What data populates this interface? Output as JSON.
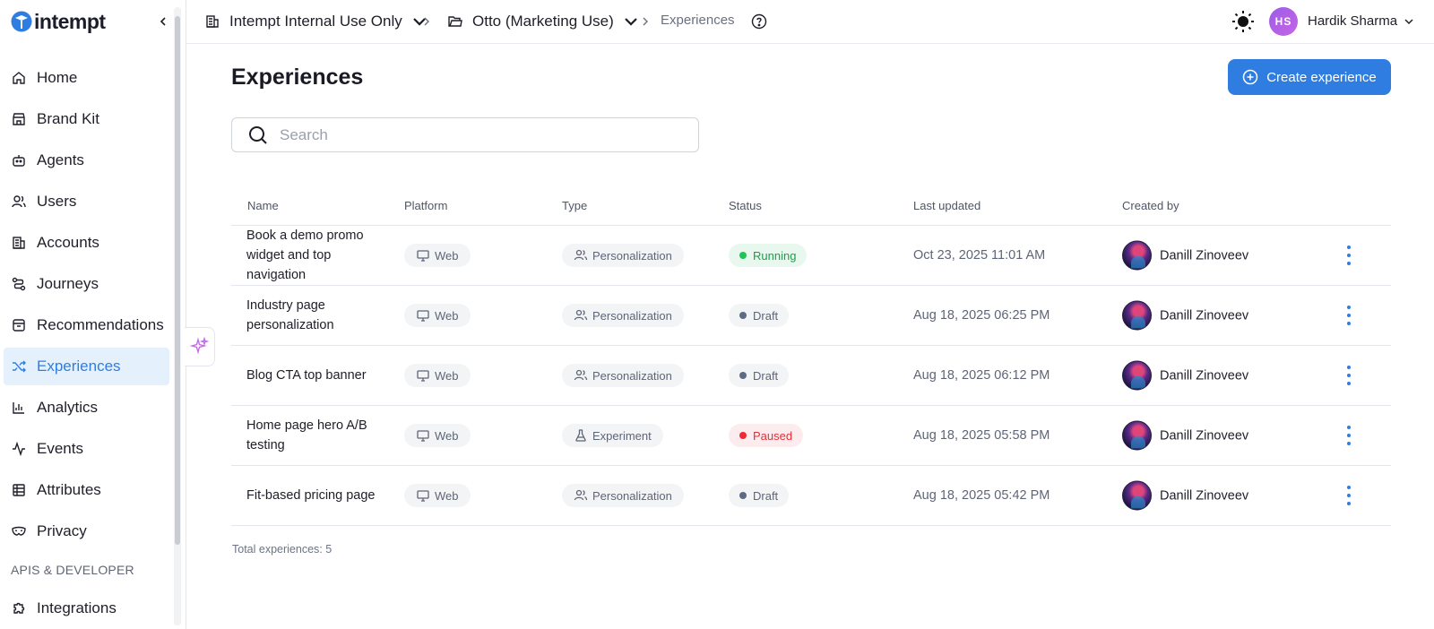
{
  "brand": {
    "logo_text": "intempt"
  },
  "sidebar": {
    "items": [
      {
        "label": "Home",
        "icon": "home-icon"
      },
      {
        "label": "Brand Kit",
        "icon": "store-icon"
      },
      {
        "label": "Agents",
        "icon": "bot-icon"
      },
      {
        "label": "Users",
        "icon": "users-icon"
      },
      {
        "label": "Accounts",
        "icon": "building-icon"
      },
      {
        "label": "Journeys",
        "icon": "route-icon"
      },
      {
        "label": "Recommendations",
        "icon": "box-icon"
      },
      {
        "label": "Experiences",
        "icon": "shuffle-icon",
        "active": true
      },
      {
        "label": "Analytics",
        "icon": "bar-chart-icon"
      },
      {
        "label": "Events",
        "icon": "activity-icon"
      },
      {
        "label": "Attributes",
        "icon": "table-icon"
      },
      {
        "label": "Privacy",
        "icon": "mask-icon"
      }
    ],
    "section_label": "APIS & DEVELOPER",
    "bottom_items": [
      {
        "label": "Integrations",
        "icon": "puzzle-icon"
      }
    ]
  },
  "topbar": {
    "org": "Intempt Internal Use Only",
    "project": "Otto (Marketing Use)",
    "current": "Experiences",
    "user_initials": "HS",
    "user_name": "Hardik Sharma"
  },
  "page": {
    "title": "Experiences",
    "create_label": "Create experience",
    "search_placeholder": "Search",
    "search_value": "",
    "total_label": "Total experiences: 5"
  },
  "table": {
    "columns": [
      "Name",
      "Platform",
      "Type",
      "Status",
      "Last updated",
      "Created by"
    ],
    "rows": [
      {
        "name": "Book a demo promo widget and top navigation",
        "platform": "Web",
        "type": "Personalization",
        "status": "Running",
        "updated": "Oct 23, 2025 11:01 AM",
        "creator": "Danill Zinoveev"
      },
      {
        "name": "Industry page personalization",
        "platform": "Web",
        "type": "Personalization",
        "status": "Draft",
        "updated": "Aug 18, 2025 06:25 PM",
        "creator": "Danill Zinoveev"
      },
      {
        "name": "Blog CTA top banner",
        "platform": "Web",
        "type": "Personalization",
        "status": "Draft",
        "updated": "Aug 18, 2025 06:12 PM",
        "creator": "Danill Zinoveev"
      },
      {
        "name": "Home page hero A/B testing",
        "platform": "Web",
        "type": "Experiment",
        "status": "Paused",
        "updated": "Aug 18, 2025 05:58 PM",
        "creator": "Danill Zinoveev"
      },
      {
        "name": "Fit-based pricing page",
        "platform": "Web",
        "type": "Personalization",
        "status": "Draft",
        "updated": "Aug 18, 2025 05:42 PM",
        "creator": "Danill Zinoveev"
      }
    ]
  },
  "colors": {
    "accent": "#2f7de1",
    "running": "#1ec454",
    "paused": "#ee2a34",
    "draft": "#5d6c85"
  }
}
